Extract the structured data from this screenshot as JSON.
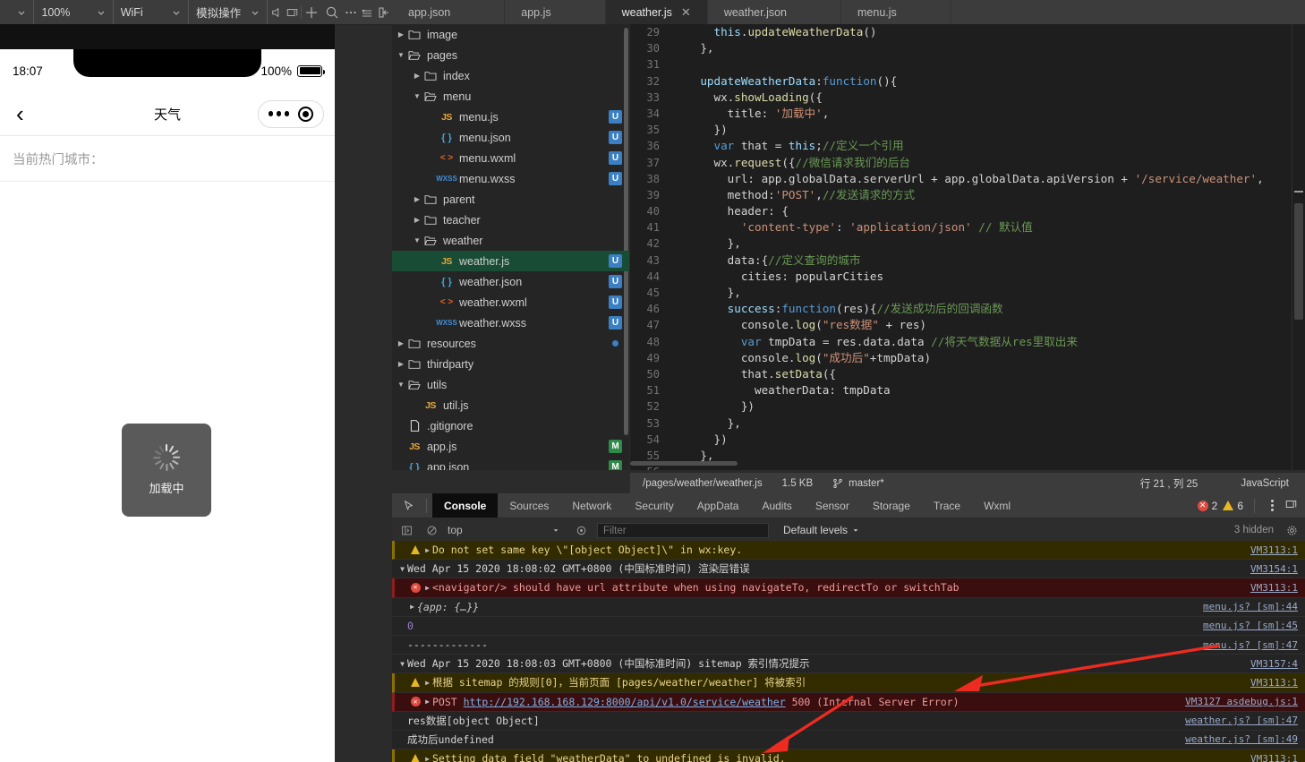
{
  "toolbar": {
    "selects": [
      {
        "name": "device-select",
        "label": ""
      },
      {
        "name": "zoom-select",
        "label": "100%"
      },
      {
        "name": "network-select",
        "label": "WiFi"
      },
      {
        "name": "simulate-select",
        "label": "模拟操作"
      }
    ],
    "icons": [
      "volume-icon",
      "rotate-screen-icon",
      "add-compile-icon",
      "search-icon",
      "more-icon",
      "list-icon",
      "panel-toggle-icon"
    ]
  },
  "simulator": {
    "status": {
      "time": "18:07",
      "battery_percent": "100%"
    },
    "nav": {
      "back_icon": "chevron-left-icon",
      "title": "天气",
      "more_icon": "ellipsis-icon",
      "target_icon": "target-icon"
    },
    "hot_city_label": "当前热门城市：",
    "loading": {
      "text": "加载中",
      "icon": "spinner-icon"
    }
  },
  "tabs": [
    {
      "label": "app.json",
      "active": false,
      "closable": false
    },
    {
      "label": "app.js",
      "active": false,
      "closable": false
    },
    {
      "label": "weather.js",
      "active": true,
      "closable": true
    },
    {
      "label": "weather.json",
      "active": false,
      "closable": false
    },
    {
      "label": "menu.js",
      "active": false,
      "closable": false
    }
  ],
  "tree": [
    {
      "label": "image",
      "depth": 1,
      "type": "folder",
      "open": false,
      "badge": "",
      "selected": false
    },
    {
      "label": "pages",
      "depth": 1,
      "type": "folder",
      "open": true,
      "badge": "",
      "selected": false
    },
    {
      "label": "index",
      "depth": 2,
      "type": "folder",
      "open": false,
      "badge": "",
      "selected": false
    },
    {
      "label": "menu",
      "depth": 2,
      "type": "folder",
      "open": true,
      "badge": "",
      "selected": false
    },
    {
      "label": "menu.js",
      "depth": 3,
      "type": "js",
      "open": false,
      "badge": "U",
      "selected": false
    },
    {
      "label": "menu.json",
      "depth": 3,
      "type": "json",
      "open": false,
      "badge": "U",
      "selected": false
    },
    {
      "label": "menu.wxml",
      "depth": 3,
      "type": "wxml",
      "open": false,
      "badge": "U",
      "selected": false
    },
    {
      "label": "menu.wxss",
      "depth": 3,
      "type": "wxss",
      "open": false,
      "badge": "U",
      "selected": false
    },
    {
      "label": "parent",
      "depth": 2,
      "type": "folder",
      "open": false,
      "badge": "",
      "selected": false
    },
    {
      "label": "teacher",
      "depth": 2,
      "type": "folder",
      "open": false,
      "badge": "",
      "selected": false
    },
    {
      "label": "weather",
      "depth": 2,
      "type": "folder",
      "open": true,
      "badge": "",
      "selected": false
    },
    {
      "label": "weather.js",
      "depth": 3,
      "type": "js",
      "open": false,
      "badge": "U",
      "selected": true
    },
    {
      "label": "weather.json",
      "depth": 3,
      "type": "json",
      "open": false,
      "badge": "U",
      "selected": false
    },
    {
      "label": "weather.wxml",
      "depth": 3,
      "type": "wxml",
      "open": false,
      "badge": "U",
      "selected": false
    },
    {
      "label": "weather.wxss",
      "depth": 3,
      "type": "wxss",
      "open": false,
      "badge": "U",
      "selected": false
    },
    {
      "label": "resources",
      "depth": 1,
      "type": "folder",
      "open": false,
      "badge": "dot",
      "selected": false
    },
    {
      "label": "thirdparty",
      "depth": 1,
      "type": "folder",
      "open": false,
      "badge": "",
      "selected": false
    },
    {
      "label": "utils",
      "depth": 1,
      "type": "folder",
      "open": true,
      "badge": "",
      "selected": false
    },
    {
      "label": "util.js",
      "depth": 2,
      "type": "js",
      "open": false,
      "badge": "",
      "selected": false
    },
    {
      "label": ".gitignore",
      "depth": 1,
      "type": "file",
      "open": false,
      "badge": "",
      "selected": false
    },
    {
      "label": "app.js",
      "depth": 1,
      "type": "js",
      "open": false,
      "badge": "M",
      "selected": false
    },
    {
      "label": "app.json",
      "depth": 1,
      "type": "json",
      "open": false,
      "badge": "M",
      "selected": false
    }
  ],
  "editor": {
    "first_line": 29,
    "lines": [
      {
        "n": 29,
        "html": "      <span class='p'>this</span>.<span class='f'>updateWeatherData</span>()"
      },
      {
        "n": 30,
        "html": "    },"
      },
      {
        "n": 31,
        "html": ""
      },
      {
        "n": 32,
        "html": "    <span class='p'>updateWeatherData</span>:<span class='k'>function</span>(){"
      },
      {
        "n": 33,
        "html": "      wx.<span class='f'>showLoading</span>({"
      },
      {
        "n": 34,
        "html": "        title: <span class='s'>'加载中'</span>,"
      },
      {
        "n": 35,
        "html": "      })"
      },
      {
        "n": 36,
        "html": "      <span class='k'>var</span> that = <span class='p'>this</span>;<span class='c'>//定义一个引用</span>"
      },
      {
        "n": 37,
        "html": "      wx.<span class='f'>request</span>({<span class='c'>//微信请求我们的后台</span>"
      },
      {
        "n": 38,
        "html": "        url: app.globalData.serverUrl + app.globalData.apiVersion + <span class='s'>'/service/weather'</span>,"
      },
      {
        "n": 39,
        "html": "        method:<span class='s'>'POST'</span>,<span class='c'>//发送请求的方式</span>"
      },
      {
        "n": 40,
        "html": "        header: {"
      },
      {
        "n": 41,
        "html": "          <span class='s'>'content-type'</span>: <span class='s'>'application/json'</span> <span class='c'>// 默认值</span>"
      },
      {
        "n": 42,
        "html": "        },"
      },
      {
        "n": 43,
        "html": "        data:{<span class='c'>//定义查询的城市</span>"
      },
      {
        "n": 44,
        "html": "          cities: popularCities"
      },
      {
        "n": 45,
        "html": "        },"
      },
      {
        "n": 46,
        "html": "        <span class='p'>success</span>:<span class='k'>function</span>(res){<span class='c'>//发送成功后的回调函数</span>"
      },
      {
        "n": 47,
        "html": "          console.<span class='f'>log</span>(<span class='s'>\"res数据\"</span> + res)"
      },
      {
        "n": 48,
        "html": "          <span class='k'>var</span> tmpData = res.data.data <span class='c'>//将天气数据从res里取出来</span>"
      },
      {
        "n": 49,
        "html": "          console.<span class='f'>log</span>(<span class='s'>\"成功后\"</span>+tmpData)"
      },
      {
        "n": 50,
        "html": "          that.<span class='f'>setData</span>({"
      },
      {
        "n": 51,
        "html": "            weatherData: tmpData"
      },
      {
        "n": 52,
        "html": "          })"
      },
      {
        "n": 53,
        "html": "        },"
      },
      {
        "n": 54,
        "html": "      })"
      },
      {
        "n": 55,
        "html": "    },"
      },
      {
        "n": 56,
        "html": ""
      }
    ]
  },
  "statusbar": {
    "path": "/pages/weather/weather.js",
    "size": "1.5 KB",
    "branch": "master*",
    "branch_icon": "git-branch-icon",
    "cursor": "行 21 , 列 25",
    "language": "JavaScript"
  },
  "devtools": {
    "inspect_icon": "inspect-element-icon",
    "tabs": [
      {
        "label": "Console",
        "active": true
      },
      {
        "label": "Sources",
        "active": false
      },
      {
        "label": "Network",
        "active": false
      },
      {
        "label": "Security",
        "active": false
      },
      {
        "label": "AppData",
        "active": false
      },
      {
        "label": "Audits",
        "active": false
      },
      {
        "label": "Sensor",
        "active": false
      },
      {
        "label": "Storage",
        "active": false
      },
      {
        "label": "Trace",
        "active": false
      },
      {
        "label": "Wxml",
        "active": false
      }
    ],
    "error_count": "2",
    "warning_count": "6",
    "more_icon": "kebab-menu-icon",
    "dock_icon": "dock-panel-icon",
    "filterbar": {
      "sidebar_icon": "show-console-sidebar-icon",
      "clear_icon": "clear-console-icon",
      "context": "top",
      "eye_icon": "live-expression-icon",
      "filter_placeholder": "Filter",
      "filter_value": "",
      "levels": "Default levels",
      "hidden": "3 hidden",
      "settings_icon": "gear-icon"
    },
    "logs": [
      {
        "level": "warn",
        "expandable": true,
        "group": false,
        "text": "Do not set same key \\\"[object Object]\\\" in wx:key.",
        "source": "VM3113:1"
      },
      {
        "level": "group",
        "expandable": true,
        "group": true,
        "text": "Wed Apr 15 2020 18:08:02 GMT+0800 (中国标准时间) 渲染层错误",
        "source": "VM3154:1"
      },
      {
        "level": "err",
        "expandable": true,
        "group": false,
        "text": "<navigator/> should have url attribute when using navigateTo, redirectTo or switchTab",
        "source": "VM3113:1"
      },
      {
        "level": "log",
        "expandable": true,
        "group": false,
        "text": "{app: {…}}",
        "source": "menu.js? [sm]:44"
      },
      {
        "level": "num",
        "expandable": false,
        "group": false,
        "text": "0",
        "source": "menu.js? [sm]:45"
      },
      {
        "level": "log",
        "expandable": false,
        "group": false,
        "text": "-------------",
        "source": "menu.js? [sm]:47"
      },
      {
        "level": "group",
        "expandable": true,
        "group": true,
        "text": "Wed Apr 15 2020 18:08:03 GMT+0800 (中国标准时间) sitemap 索引情况提示",
        "source": "VM3157:4"
      },
      {
        "level": "warn",
        "expandable": true,
        "group": false,
        "text": "根据 sitemap 的规则[0]，当前页面 [pages/weather/weather] 将被索引",
        "source": "VM3113:1"
      },
      {
        "level": "err-link",
        "expandable": true,
        "group": false,
        "prefix": "POST ",
        "link": "http://192.168.168.129:8000/api/v1.0/service/weather",
        "suffix": " 500 (Internal Server Error)",
        "text": "POST http://192.168.168.129:8000/api/v1.0/service/weather 500 (Internal Server Error)",
        "source": "VM3127 asdebug.js:1"
      },
      {
        "level": "log",
        "expandable": false,
        "group": false,
        "text": "res数据[object Object]",
        "source": "weather.js? [sm]:47"
      },
      {
        "level": "log",
        "expandable": false,
        "group": false,
        "text": "成功后undefined",
        "source": "weather.js? [sm]:49"
      },
      {
        "level": "warn",
        "expandable": true,
        "group": false,
        "text": "Setting data field \"weatherData\" to undefined is invalid.",
        "source": "VM3113:1"
      }
    ]
  },
  "annotations": {
    "arrow_color": "#ee2b21",
    "arrows": [
      "arrow-to-post-error",
      "arrow-to-setting-data-warning"
    ]
  }
}
